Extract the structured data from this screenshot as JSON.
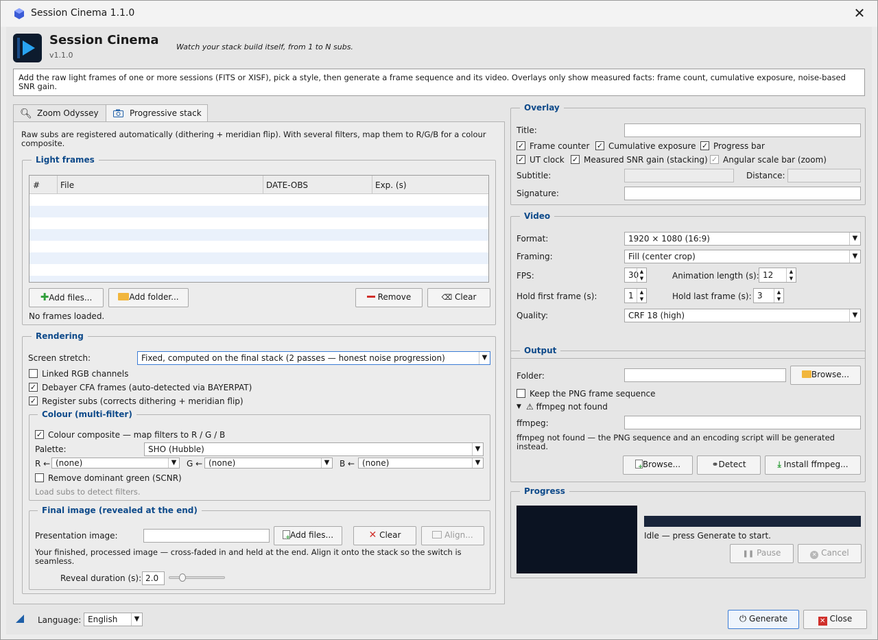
{
  "window": {
    "title": "Session Cinema 1.1.0"
  },
  "header": {
    "title": "Session Cinema",
    "version": "v1.1.0",
    "tagline": "Watch your stack build itself, from 1 to N subs."
  },
  "intro": "Add the raw light frames of one or more sessions (FITS or XISF), pick a style, then generate a frame sequence and its video. Overlays only show measured facts: frame count, cumulative exposure, noise-based SNR gain.",
  "tabs": [
    {
      "label": "Zoom Odyssey",
      "icon": "search-icon"
    },
    {
      "label": "Progressive stack",
      "icon": "camera-icon"
    }
  ],
  "progressive": {
    "description": "Raw subs are registered automatically (dithering + meridian flip). With several filters, map them to R/G/B for a colour composite.",
    "light_frames": {
      "title": "Light frames",
      "columns": [
        "#",
        "File",
        "DATE-OBS",
        "Exp. (s)"
      ],
      "add_files": "Add files...",
      "add_folder": "Add folder...",
      "remove": "Remove",
      "clear": "Clear",
      "status": "No frames loaded."
    },
    "rendering": {
      "title": "Rendering",
      "screen_stretch_label": "Screen stretch:",
      "screen_stretch_value": "Fixed, computed on the final stack (2 passes — honest noise progression)",
      "linked_rgb": "Linked RGB channels",
      "linked_rgb_checked": false,
      "debayer": "Debayer CFA frames (auto-detected via BAYERPAT)",
      "debayer_checked": true,
      "register": "Register subs (corrects dithering + meridian flip)",
      "register_checked": true
    },
    "colour": {
      "title": "Colour (multi-filter)",
      "composite": "Colour composite — map filters to R / G / B",
      "composite_checked": true,
      "palette_label": "Palette:",
      "palette_value": "SHO (Hubble)",
      "r_label": "R ←",
      "r_value": "(none)",
      "g_label": "G ←",
      "g_value": "(none)",
      "b_label": "B ←",
      "b_value": "(none)",
      "scnr": "Remove dominant green (SCNR)",
      "scnr_checked": false,
      "hint": "Load subs to detect filters."
    },
    "final_image": {
      "title": "Final image (revealed at the end)",
      "presentation_label": "Presentation image:",
      "presentation_value": "",
      "add_files": "Add files...",
      "clear": "Clear",
      "align": "Align...",
      "description": "Your finished, processed image — cross-faded in and held at the end. Align it onto the stack so the switch is seamless.",
      "reveal_label": "Reveal duration (s):",
      "reveal_value": "2.0",
      "reveal_slider_fraction": 0.2
    }
  },
  "overlay": {
    "title": "Overlay",
    "title_label": "Title:",
    "title_value": "",
    "frame_counter": "Frame counter",
    "frame_counter_checked": true,
    "cumulative_exposure": "Cumulative exposure",
    "cumulative_exposure_checked": true,
    "progress_bar": "Progress bar",
    "progress_bar_checked": true,
    "ut_clock": "UT clock",
    "ut_clock_checked": true,
    "snr_gain": "Measured SNR gain (stacking)",
    "snr_gain_checked": true,
    "scale_bar": "Angular scale bar (zoom)",
    "scale_bar_checked": true,
    "subtitle_label": "Subtitle:",
    "distance_label": "Distance:",
    "signature_label": "Signature:",
    "signature_value": ""
  },
  "video": {
    "title": "Video",
    "format_label": "Format:",
    "format_value": "1920 × 1080  (16:9)",
    "framing_label": "Framing:",
    "framing_value": "Fill (center crop)",
    "fps_label": "FPS:",
    "fps_value": "30",
    "anim_label": "Animation length (s):",
    "anim_value": "12",
    "hold_first_label": "Hold first frame (s):",
    "hold_first_value": "1",
    "hold_last_label": "Hold last frame (s):",
    "hold_last_value": "3",
    "quality_label": "Quality:",
    "quality_value": "CRF 18 (high)"
  },
  "output": {
    "title": "Output",
    "folder_label": "Folder:",
    "folder_value": "",
    "browse": "Browse...",
    "keep_png": "Keep the PNG frame sequence",
    "keep_png_checked": false,
    "ffmpeg_toggle": "⚠ ffmpeg not found",
    "ffmpeg_label": "ffmpeg:",
    "ffmpeg_value": "",
    "ffmpeg_note": "ffmpeg not found — the PNG sequence and an encoding script will be generated instead.",
    "browse2": "Browse...",
    "detect": "Detect",
    "install": "Install ffmpeg..."
  },
  "progress": {
    "title": "Progress",
    "status": "Idle — press Generate to start.",
    "pause": "Pause",
    "cancel": "Cancel",
    "fraction": 0
  },
  "footer": {
    "language_label": "Language:",
    "language_value": "English",
    "generate": "Generate",
    "close": "Close"
  },
  "colors": {
    "accent": "#0e4a8a",
    "preview_bg": "#0b1322",
    "progress_bg": "#18243a",
    "clear_red": "#d0302b",
    "add_green": "#2f9e3a"
  }
}
